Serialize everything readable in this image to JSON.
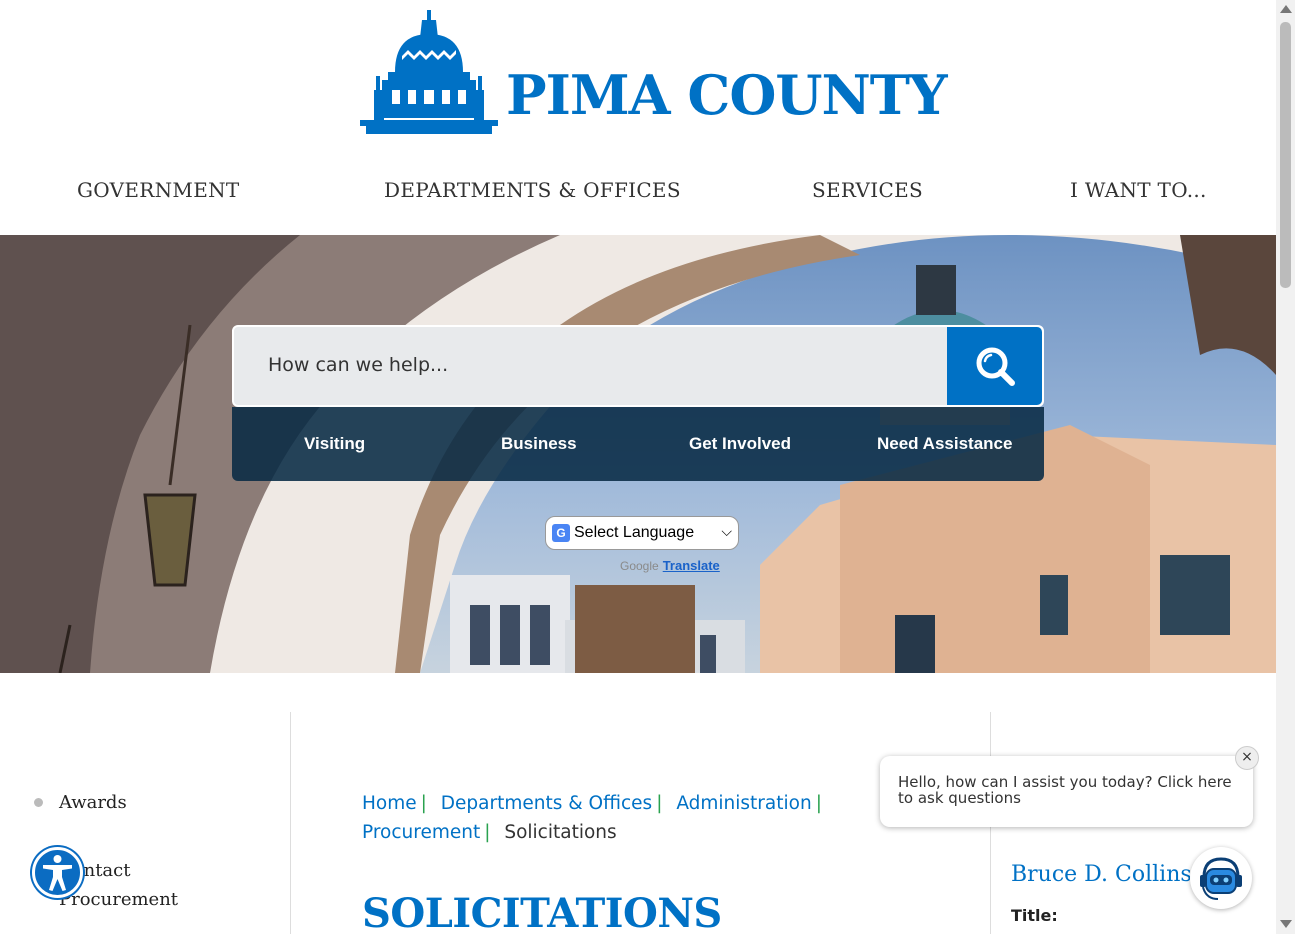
{
  "header": {
    "logo_text": "PIMA COUNTY"
  },
  "nav": {
    "items": [
      {
        "label": "GOVERNMENT"
      },
      {
        "label": "DEPARTMENTS & OFFICES"
      },
      {
        "label": "SERVICES"
      },
      {
        "label": "I WANT TO..."
      }
    ]
  },
  "search": {
    "placeholder": "How can we help..."
  },
  "quick_links": [
    {
      "label": "Visiting"
    },
    {
      "label": "Business"
    },
    {
      "label": "Get Involved"
    },
    {
      "label": "Need Assistance"
    }
  ],
  "translate": {
    "select_label": "Select Language",
    "google": "Google",
    "translate_link": "Translate"
  },
  "sidebar": {
    "items": [
      {
        "label": "Awards"
      },
      {
        "label": "Contact"
      },
      {
        "label": "Procurement"
      }
    ]
  },
  "breadcrumb": {
    "items": [
      "Home",
      "Departments & Offices",
      "Administration",
      "Procurement"
    ],
    "current": "Solicitations"
  },
  "page": {
    "title": "SOLICITATIONS"
  },
  "contact": {
    "name": "Bruce D. Collins",
    "title_label": "Title:"
  },
  "chat": {
    "message": "Hello, how can I assist you today? Click here to ask questions",
    "close": "×"
  },
  "colors": {
    "brand_blue": "#0071c5",
    "separator_green": "#2aa24f",
    "quicklinks_bg": "#082a44"
  }
}
